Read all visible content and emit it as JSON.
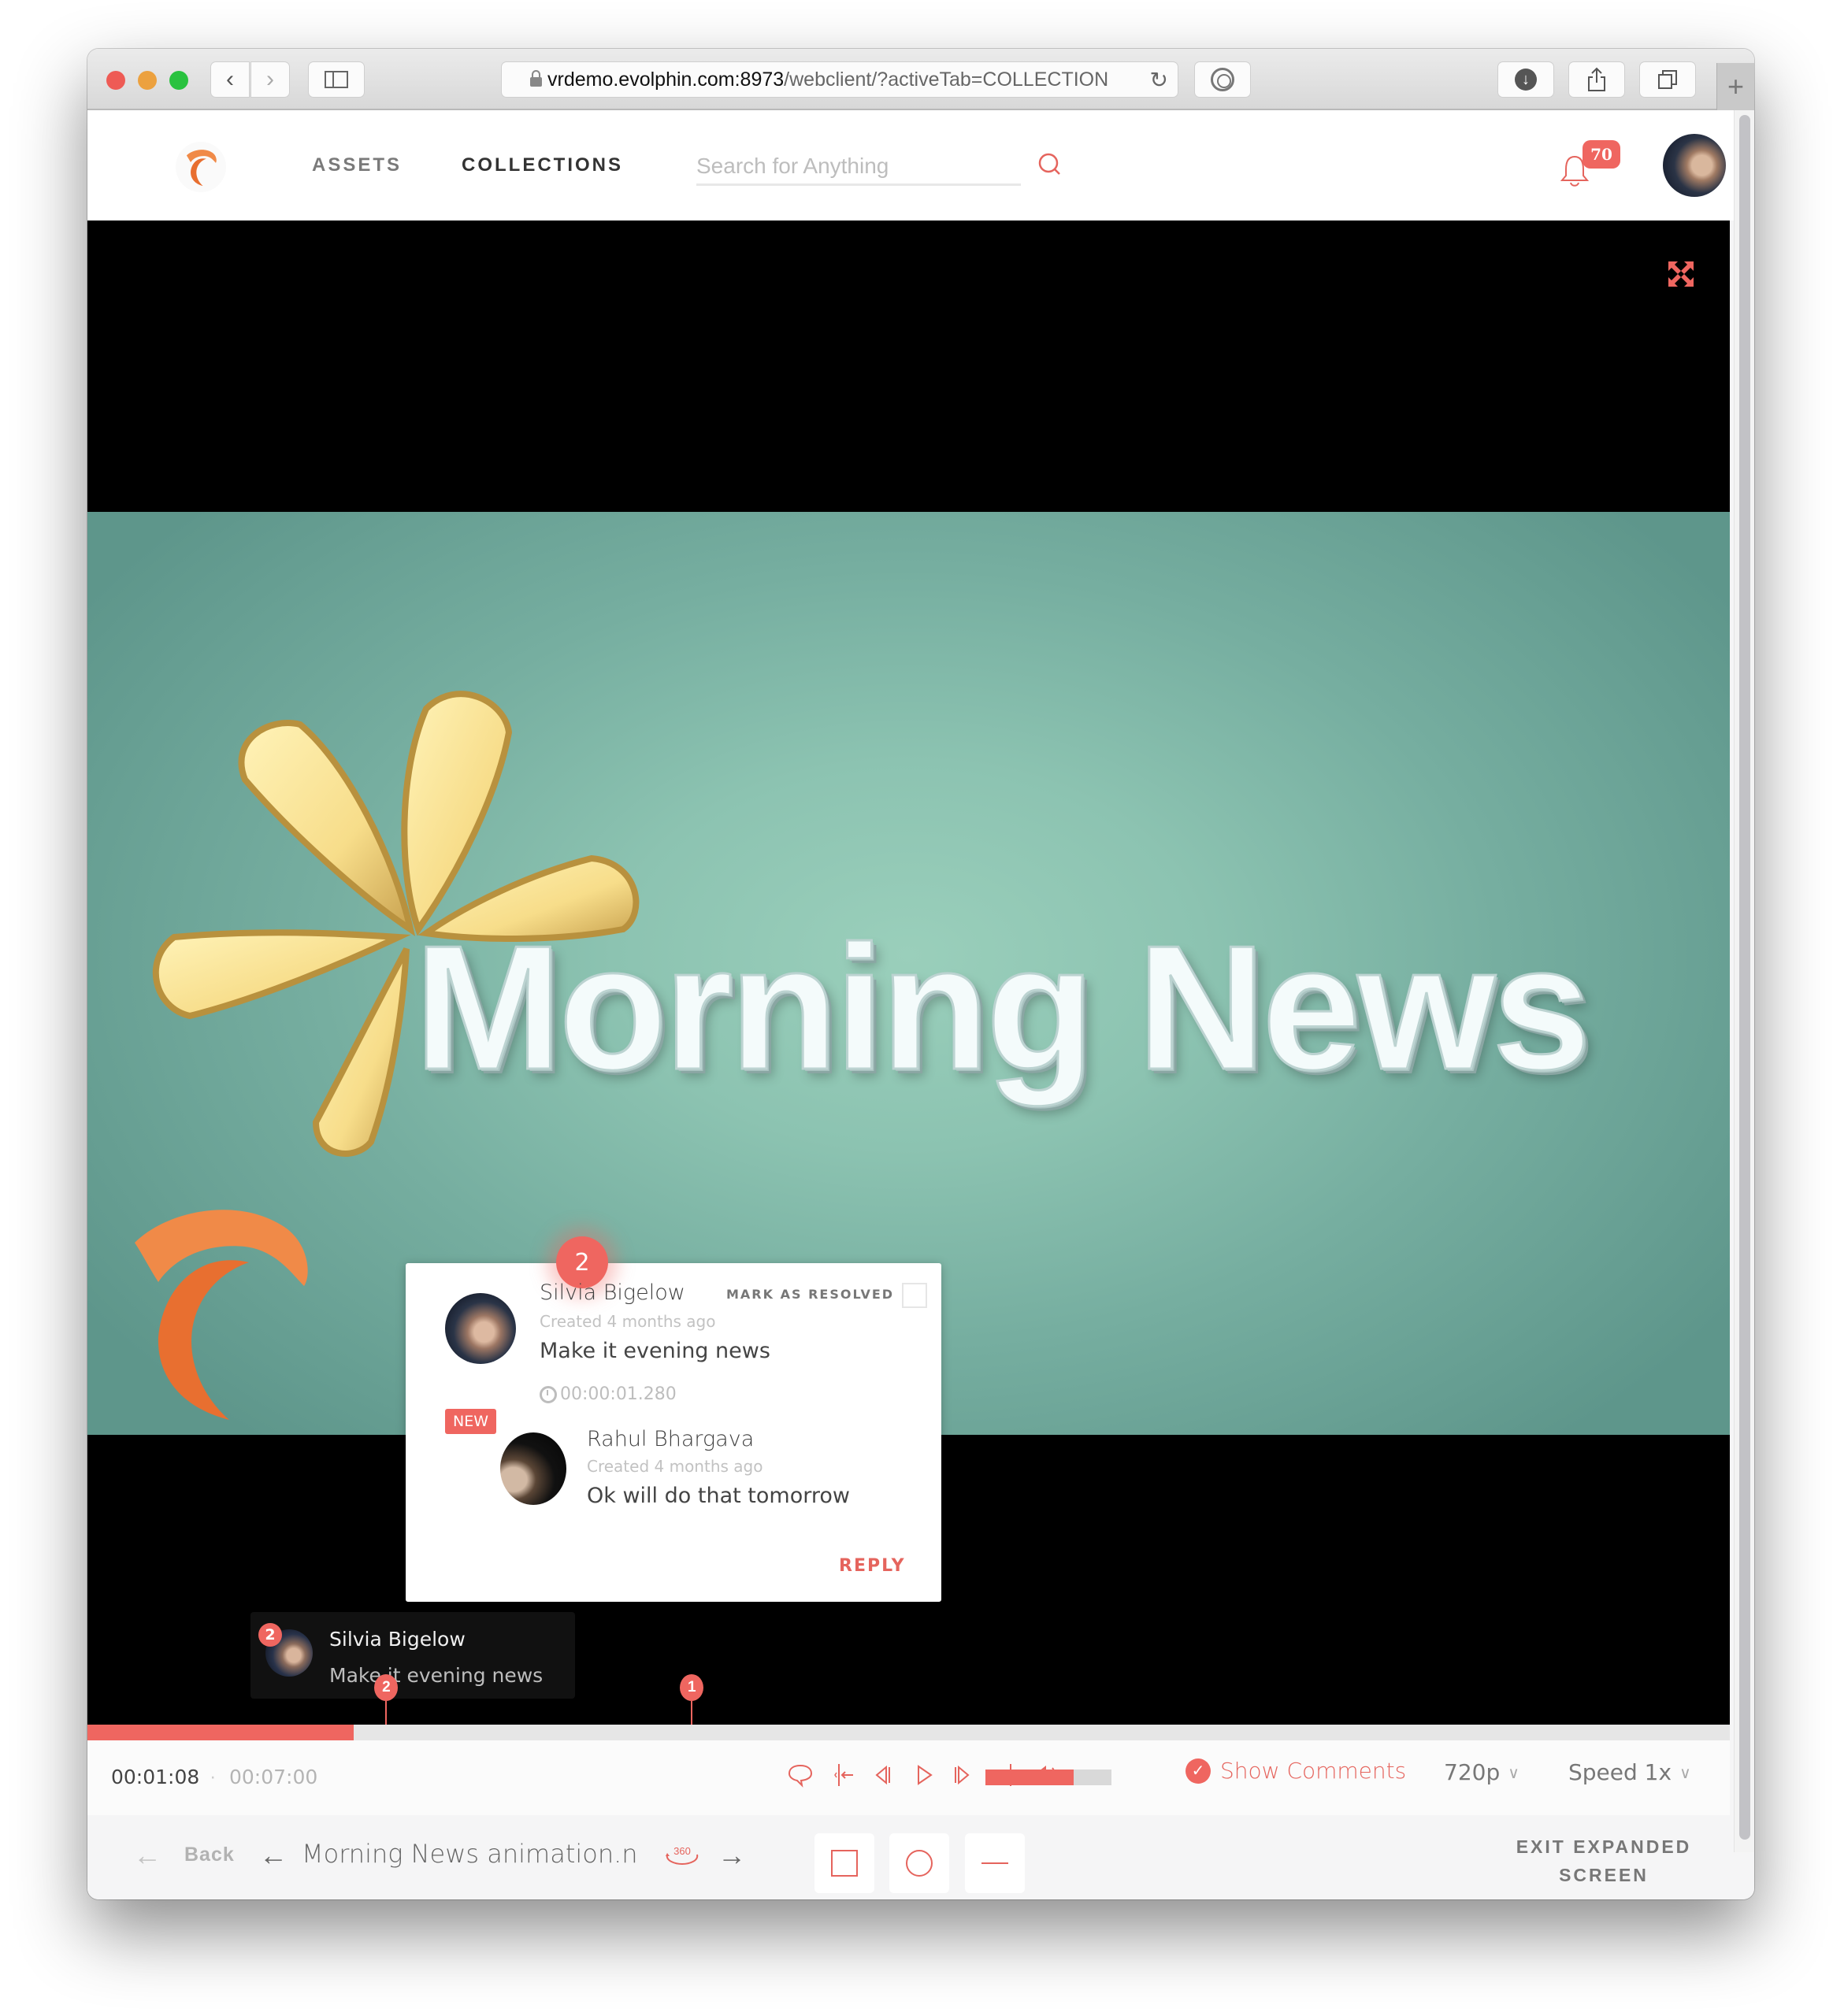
{
  "browser": {
    "url_host": "vrdemo.evolphin.com:8973",
    "url_path": "/webclient/?activeTab=COLLECTION",
    "back_icon": "chevron-left-icon",
    "forward_icon": "chevron-right-icon",
    "new_tab_label": "+"
  },
  "header": {
    "nav": [
      {
        "label": "ASSETS",
        "active": false
      },
      {
        "label": "COLLECTIONS",
        "active": true
      }
    ],
    "search": {
      "placeholder": "Search for Anything",
      "value": ""
    },
    "notifications_count": "70",
    "accent_color": "#ef6660"
  },
  "video": {
    "frame_title": "Morning News",
    "expand_icon": "expand-arrows-icon"
  },
  "comment_card": {
    "pin_number": "2",
    "author": "Silvia Bigelow",
    "created": "Created 4 months ago",
    "text": "Make it evening news",
    "timestamp": "00:00:01.280",
    "mark_resolved_label": "MARK AS RESOLVED",
    "resolved": false,
    "reply": {
      "badge": "NEW",
      "author": "Rahul Bhargava",
      "created": "Created 4 months ago",
      "text": "Ok will do that tomorrow"
    },
    "reply_button": "REPLY"
  },
  "comment_tooltip": {
    "pin_number": "2",
    "author": "Silvia Bigelow",
    "text": "Make it evening news"
  },
  "timeline": {
    "progress_fraction": 0.162,
    "markers": [
      {
        "label": "2",
        "position_fraction": 0.182
      },
      {
        "label": "1",
        "position_fraction": 0.368
      }
    ]
  },
  "controls": {
    "current_time": "00:01:08",
    "separator": "·",
    "total_time": "00:07:00",
    "volume_fraction": 0.7,
    "show_comments_label": "Show Comments",
    "show_comments_checked": true,
    "quality": "720p",
    "speed": "Speed 1x"
  },
  "bottom_bar": {
    "back_label": "Back",
    "asset_name": "Morning News animation.n",
    "badge_360": "360",
    "exit_label_line1": "EXIT EXPANDED",
    "exit_label_line2": "SCREEN"
  }
}
